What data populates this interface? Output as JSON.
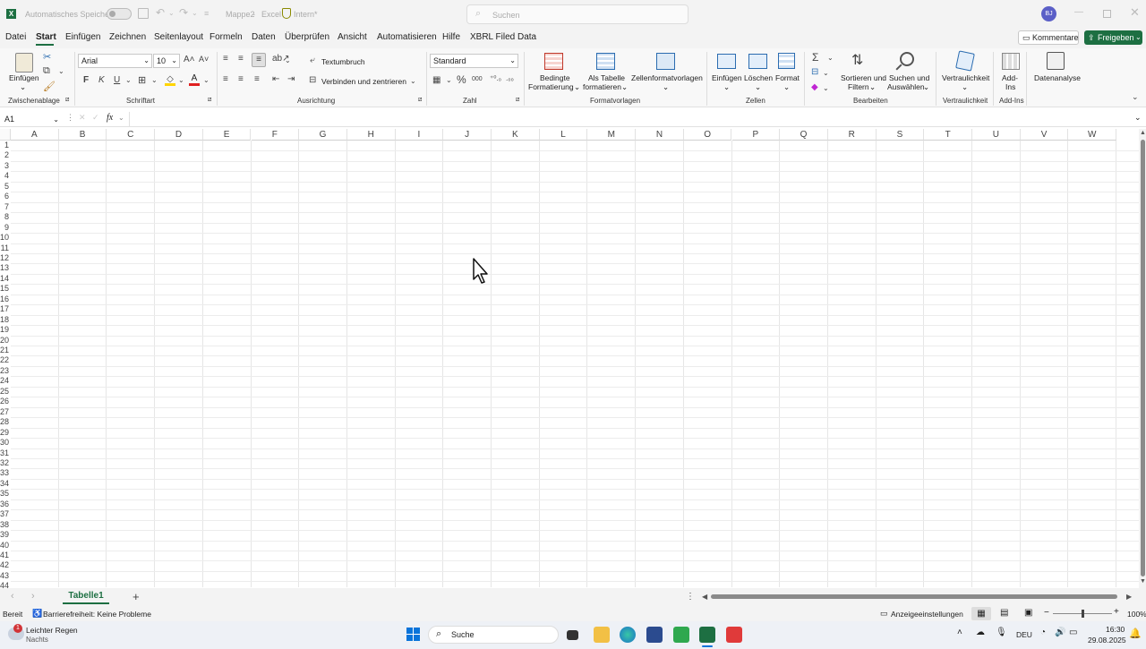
{
  "titlebar": {
    "autosave_label": "Automatisches Speichern",
    "doc_title": "Mappe2",
    "app_name": "Excel",
    "sensitivity": "Intern*",
    "search_placeholder": "Suchen",
    "user_initials": "BJ"
  },
  "menu": {
    "tabs": [
      "Datei",
      "Start",
      "Einfügen",
      "Zeichnen",
      "Seitenlayout",
      "Formeln",
      "Daten",
      "Überprüfen",
      "Ansicht",
      "Automatisieren",
      "Hilfe",
      "XBRL Filed Data"
    ],
    "active_tab": "Start",
    "comments_label": "Kommentare",
    "share_label": "Freigeben"
  },
  "ribbon": {
    "clipboard": {
      "paste_label": "Einfügen",
      "group_label": "Zwischenablage"
    },
    "font": {
      "font_name": "Arial",
      "font_size": "10",
      "bold": "F",
      "italic": "K",
      "underline": "U",
      "group_label": "Schriftart"
    },
    "alignment": {
      "wrap_label": "Textumbruch",
      "merge_label": "Verbinden und zentrieren",
      "group_label": "Ausrichtung"
    },
    "number": {
      "format": "Standard",
      "group_label": "Zahl"
    },
    "styles": {
      "conditional_1": "Bedingte",
      "conditional_2": "Formatierung",
      "table_1": "Als Tabelle",
      "table_2": "formatieren",
      "cell_styles": "Zellenformatvorlagen",
      "group_label": "Formatvorlagen"
    },
    "cells": {
      "insert": "Einfügen",
      "delete": "Löschen",
      "format": "Format",
      "group_label": "Zellen"
    },
    "editing": {
      "sort_1": "Sortieren und",
      "sort_2": "Filtern",
      "find_1": "Suchen und",
      "find_2": "Auswählen",
      "group_label": "Bearbeiten"
    },
    "sensitivity": {
      "label": "Vertraulichkeit",
      "group_label": "Vertraulichkeit"
    },
    "addins": {
      "label_1": "Add-",
      "label_2": "Ins",
      "group_label": "Add-Ins"
    },
    "analysis": {
      "label": "Datenanalyse"
    }
  },
  "formula_bar": {
    "name_box": "A1",
    "fx": "fx",
    "formula": ""
  },
  "sheet": {
    "columns": [
      "A",
      "B",
      "C",
      "D",
      "E",
      "F",
      "G",
      "H",
      "I",
      "J",
      "K",
      "L",
      "M",
      "N",
      "O",
      "P",
      "Q",
      "R",
      "S",
      "T",
      "U",
      "V",
      "W"
    ],
    "rows": [
      "1",
      "2",
      "3",
      "4",
      "5",
      "6",
      "7",
      "8",
      "9",
      "10",
      "11",
      "12",
      "13",
      "14",
      "15",
      "16",
      "17",
      "18",
      "19",
      "20",
      "21",
      "22",
      "23",
      "24",
      "25",
      "26",
      "27",
      "28",
      "29",
      "30",
      "31",
      "32",
      "33",
      "34",
      "35",
      "36",
      "37",
      "38",
      "39",
      "40",
      "41",
      "42",
      "43",
      "44"
    ]
  },
  "sheet_tabs": {
    "active": "Tabelle1"
  },
  "status": {
    "ready": "Bereit",
    "accessibility": "Barrierefreiheit: Keine Probleme",
    "display_settings": "Anzeigeeinstellungen",
    "zoom": "100%"
  },
  "taskbar": {
    "weather_badge": "1",
    "weather_title": "Leichter Regen",
    "weather_sub": "Nachts",
    "search_label": "Suche",
    "language": "DEU",
    "time": "16:30",
    "date": "29.08.2025"
  }
}
